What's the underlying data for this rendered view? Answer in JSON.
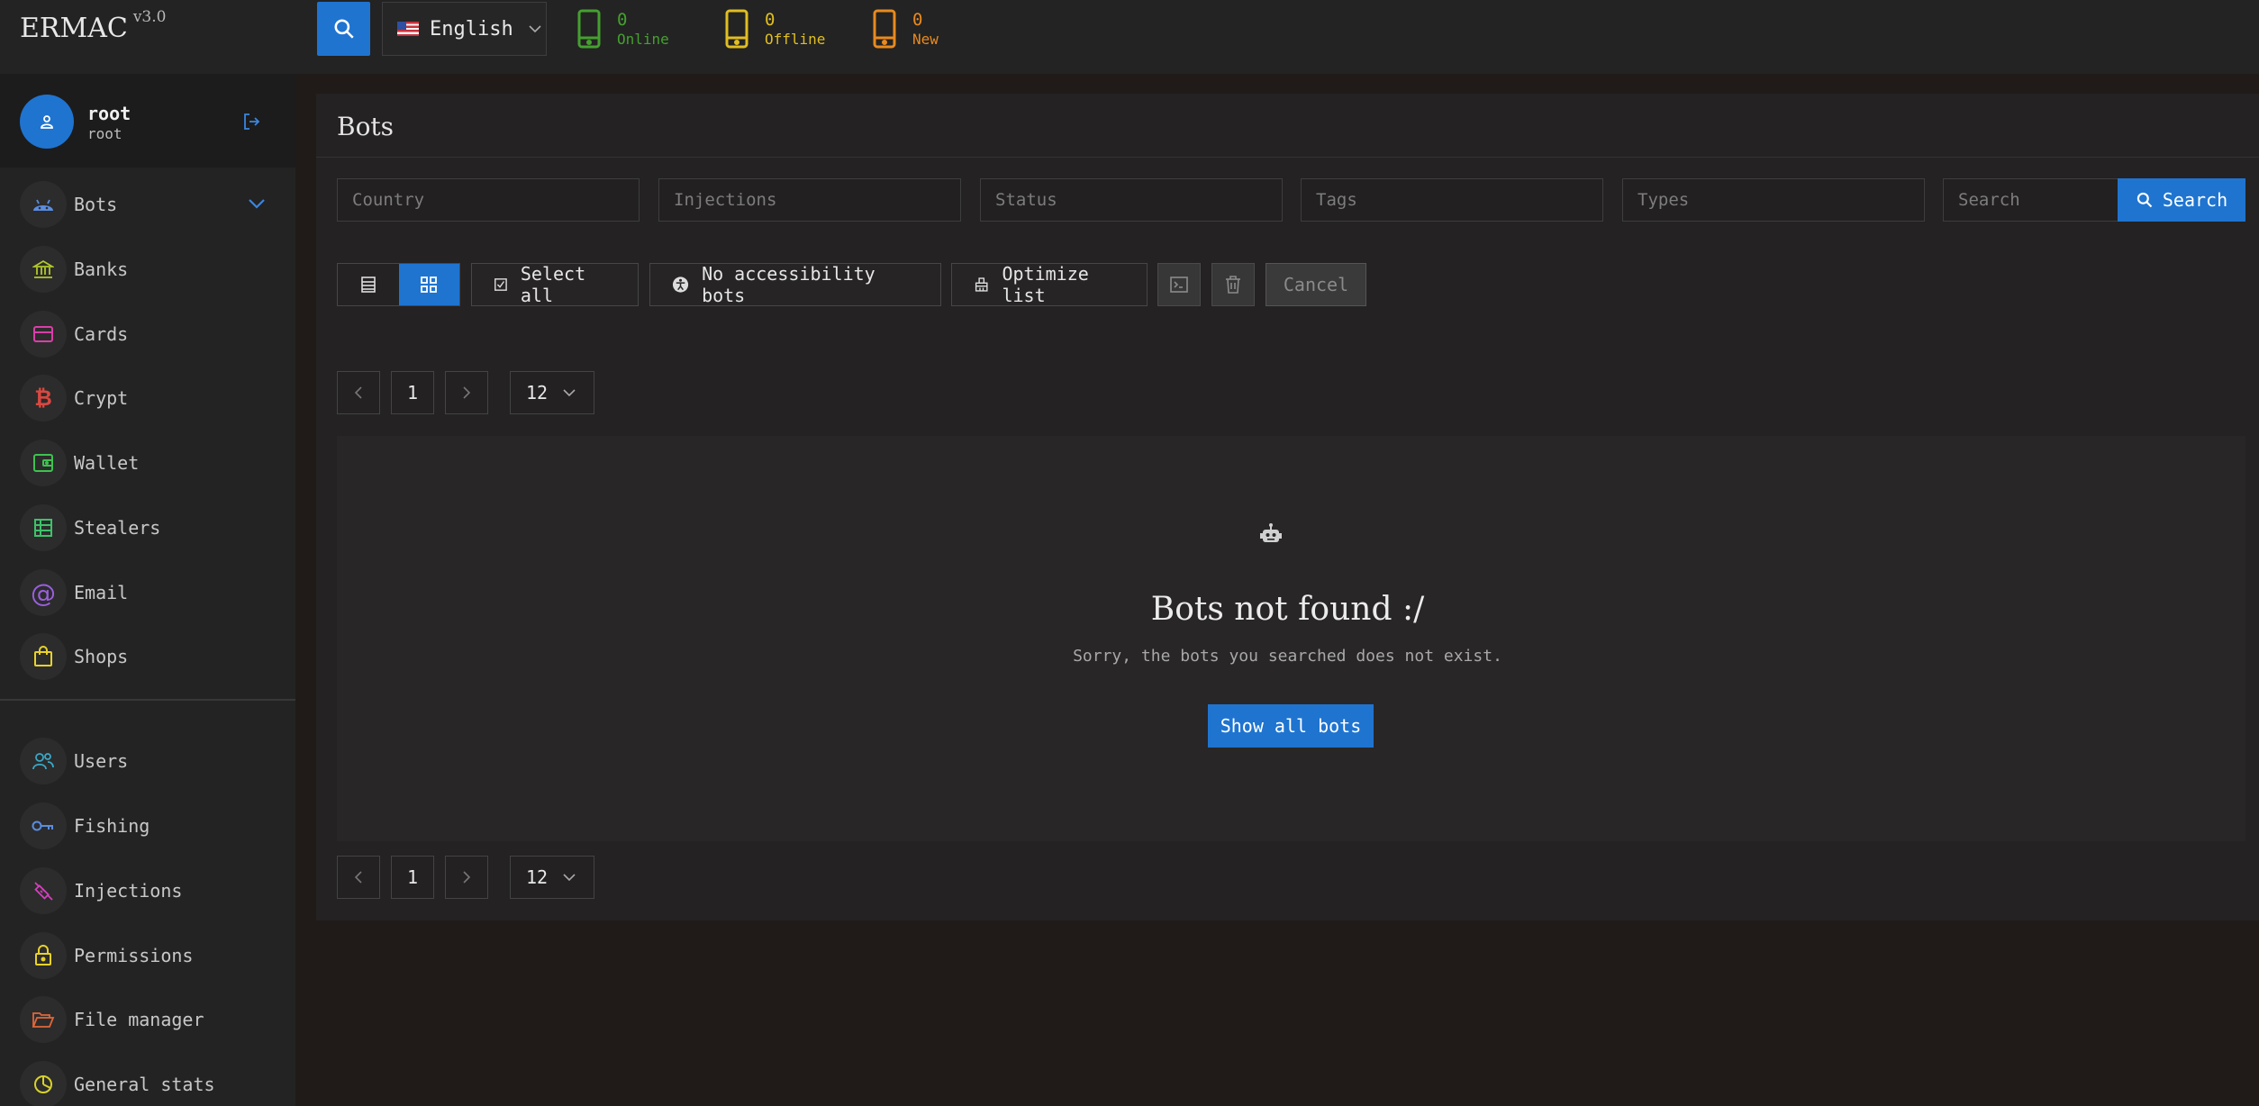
{
  "app": {
    "name": "ERMAC",
    "version": "v3.0"
  },
  "header": {
    "language": "English",
    "stats": {
      "online": {
        "count": "0",
        "label": "Online"
      },
      "offline": {
        "count": "0",
        "label": "Offline"
      },
      "new": {
        "count": "0",
        "label": "New"
      }
    }
  },
  "user": {
    "name": "root",
    "role": "root"
  },
  "sidebar": {
    "items": [
      {
        "label": "Bots",
        "icon": "android-icon",
        "color": "#5a8de0"
      },
      {
        "label": "Banks",
        "icon": "bank-icon",
        "color": "#b3c82b"
      },
      {
        "label": "Cards",
        "icon": "credit-card-icon",
        "color": "#d93fa8"
      },
      {
        "label": "Crypt",
        "icon": "bitcoin-icon",
        "color": "#d94840"
      },
      {
        "label": "Wallet",
        "icon": "wallet-icon",
        "color": "#3ec24f"
      },
      {
        "label": "Stealers",
        "icon": "table-icon",
        "color": "#3ec26a"
      },
      {
        "label": "Email",
        "icon": "at-sign-icon",
        "color": "#9b5fe0"
      },
      {
        "label": "Shops",
        "icon": "shopping-bag-icon",
        "color": "#e8d22a"
      },
      {
        "label": "Users",
        "icon": "users-icon",
        "color": "#3aa8c8"
      },
      {
        "label": "Fishing",
        "icon": "key-icon",
        "color": "#5a8de0"
      },
      {
        "label": "Injections",
        "icon": "syringe-icon",
        "color": "#d63fbf"
      },
      {
        "label": "Permissions",
        "icon": "lock-icon",
        "color": "#e8d22a"
      },
      {
        "label": "File manager",
        "icon": "folder-open-icon",
        "color": "#e0673a"
      },
      {
        "label": "General stats",
        "icon": "pie-chart-icon",
        "color": "#d8d22a"
      }
    ]
  },
  "main": {
    "title": "Bots",
    "filters": {
      "country": "Country",
      "injections": "Injections",
      "status": "Status",
      "tags": "Tags",
      "types": "Types",
      "search": "Search"
    },
    "search_button": "Search",
    "toolbar": {
      "select_all": "Select all",
      "no_accessibility": "No accessibility bots",
      "optimize": "Optimize list",
      "cancel": "Cancel"
    },
    "pagination": {
      "page": "1",
      "per_page": "12"
    },
    "empty": {
      "title": "Bots not found :/",
      "subtitle": "Sorry, the bots you searched does not exist.",
      "button": "Show all bots"
    }
  },
  "colors": {
    "accent": "#1f74d0",
    "online": "#45a02f",
    "offline": "#e0be22",
    "new": "#e98a1e"
  }
}
